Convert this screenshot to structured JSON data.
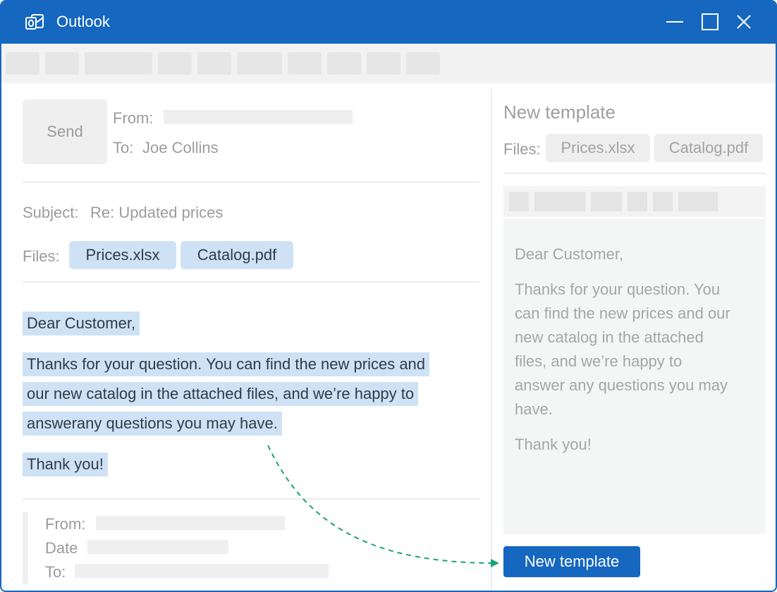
{
  "app": {
    "title": "Outlook",
    "accent_color": "#1567c0",
    "highlight_color": "#cfe2f5",
    "arrow_color": "#1aa37a"
  },
  "compose": {
    "send_label": "Send",
    "from_label": "From:",
    "to_label": "To:",
    "to_value": "Joe Collins",
    "subject_label": "Subject:",
    "subject_value": "Re: Updated prices",
    "files_label": "Files:",
    "files": [
      "Prices.xlsx",
      "Catalog.pdf"
    ],
    "body": {
      "greeting": "Dear Customer,",
      "lines": [
        "Thanks for your question. You can find the new prices and",
        "our new catalog in the attached files, and we’re happy to",
        "answerany questions you may have."
      ],
      "closing": "Thank you!"
    },
    "quoted": {
      "from_label": "From:",
      "date_label": "Date",
      "to_label": "To:"
    }
  },
  "template": {
    "title": "New template",
    "files_label": "Files:",
    "files": [
      "Prices.xlsx",
      "Catalog.pdf"
    ],
    "body": {
      "greeting": "Dear Customer,",
      "lines": [
        "Thanks for your question. You",
        "can find the new prices and our",
        "new catalog in the attached",
        "files, and we’re happy to",
        "answer any questions you may",
        "have."
      ],
      "closing": "Thank you!"
    },
    "button_label": "New template"
  }
}
